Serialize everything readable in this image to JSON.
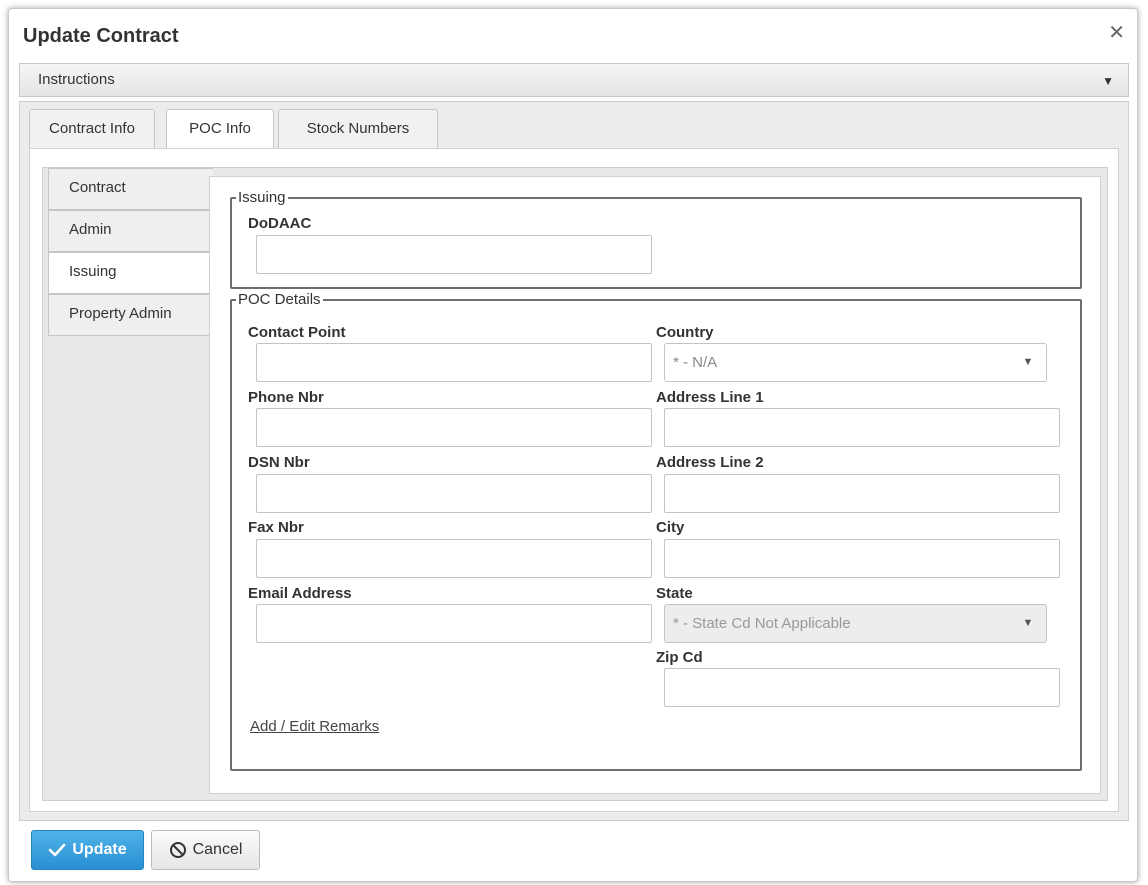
{
  "dialog": {
    "title": "Update Contract",
    "close_glyph": "✕"
  },
  "instructions": {
    "label": "Instructions",
    "toggle_glyph": "▼"
  },
  "tabs": [
    {
      "label": "Contract Info"
    },
    {
      "label": "POC Info"
    },
    {
      "label": "Stock Numbers"
    }
  ],
  "side_tabs": [
    {
      "label": "Contract"
    },
    {
      "label": "Admin"
    },
    {
      "label": "Issuing"
    },
    {
      "label": "Property Admin"
    }
  ],
  "issuing": {
    "legend": "Issuing",
    "dodaac_label": "DoDAAC",
    "dodaac_value": ""
  },
  "poc": {
    "legend": "POC Details",
    "contact_point_label": "Contact Point",
    "contact_point_value": "",
    "phone_label": "Phone Nbr",
    "phone_value": "",
    "dsn_label": "DSN Nbr",
    "dsn_value": "",
    "fax_label": "Fax Nbr",
    "fax_value": "",
    "email_label": "Email Address",
    "email_value": "",
    "country_label": "Country",
    "country_selected": "* - N/A",
    "address1_label": "Address Line 1",
    "address1_value": "",
    "address2_label": "Address Line 2",
    "address2_value": "",
    "city_label": "City",
    "city_value": "",
    "state_label": "State",
    "state_selected": "* - State Cd Not Applicable",
    "zip_label": "Zip Cd",
    "zip_value": "",
    "remarks_link": "Add / Edit Remarks",
    "caret_glyph": "▼"
  },
  "buttons": {
    "update_label": "Update",
    "update_icon": "checkmark-icon",
    "cancel_label": "Cancel",
    "cancel_icon": "ban-icon"
  },
  "colors": {
    "primary_button": "#2a8fd1",
    "tab_area": "#ececec"
  }
}
